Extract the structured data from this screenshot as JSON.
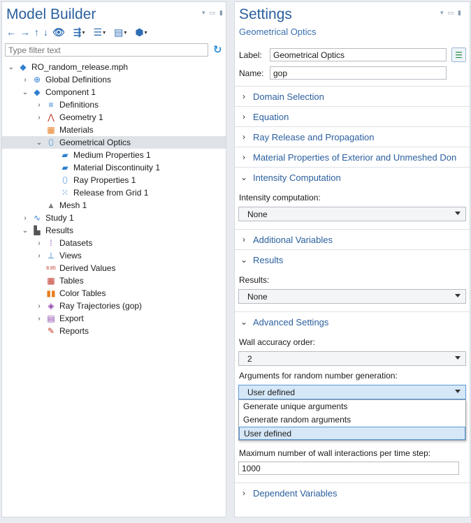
{
  "model_builder": {
    "title": "Model Builder",
    "filter_placeholder": "Type filter text",
    "toolbar": [
      {
        "name": "back-icon",
        "glyph": "←"
      },
      {
        "name": "forward-icon",
        "glyph": "→"
      },
      {
        "name": "move-up-icon",
        "glyph": "↑"
      },
      {
        "name": "move-down-icon",
        "glyph": "↓"
      },
      {
        "name": "show-icon",
        "glyph": "👁"
      },
      {
        "name": "expand-icon",
        "glyph": "⇶"
      },
      {
        "name": "collapse-icon",
        "glyph": "☰"
      },
      {
        "name": "list-icon",
        "glyph": "▤"
      },
      {
        "name": "build-icon",
        "glyph": "⬢"
      }
    ],
    "tree": [
      {
        "label": "RO_random_release.mph",
        "arrow": "⌄",
        "icon": "file-icon",
        "glyph": "◆",
        "color": "#2f7fd0"
      },
      {
        "label": "Global Definitions",
        "arrow": "›",
        "icon": "globe-icon",
        "glyph": "⊕",
        "color": "#2f7fd0"
      },
      {
        "label": "Component 1",
        "arrow": "⌄",
        "icon": "component-icon",
        "glyph": "◆",
        "color": "#2f7fd0"
      },
      {
        "label": "Definitions",
        "arrow": "›",
        "icon": "definitions-icon",
        "glyph": "≡",
        "color": "#2f7fd0"
      },
      {
        "label": "Geometry 1",
        "arrow": "›",
        "icon": "geometry-icon",
        "glyph": "⋀",
        "color": "#c0392b"
      },
      {
        "label": "Materials",
        "arrow": "",
        "icon": "materials-icon",
        "glyph": "▦",
        "color": "#e67e22"
      },
      {
        "label": "Geometrical Optics",
        "arrow": "⌄",
        "icon": "optics-icon",
        "glyph": "⬯",
        "color": "#2f7fd0"
      },
      {
        "label": "Medium Properties 1",
        "arrow": "",
        "icon": "medium-properties-icon",
        "glyph": "▰",
        "color": "#2f7fd0"
      },
      {
        "label": "Material Discontinuity 1",
        "arrow": "",
        "icon": "material-discontinuity-icon",
        "glyph": "▰",
        "color": "#2f7fd0"
      },
      {
        "label": "Ray Properties 1",
        "arrow": "",
        "icon": "ray-properties-icon",
        "glyph": "⬯",
        "color": "#2f7fd0"
      },
      {
        "label": "Release from Grid 1",
        "arrow": "",
        "icon": "release-grid-icon",
        "glyph": "⁙",
        "color": "#2f7fd0"
      },
      {
        "label": "Mesh 1",
        "arrow": "",
        "icon": "mesh-icon",
        "glyph": "▲",
        "color": "#808080"
      },
      {
        "label": "Study 1",
        "arrow": "›",
        "icon": "study-icon",
        "glyph": "∿",
        "color": "#2f7fd0"
      },
      {
        "label": "Results",
        "arrow": "⌄",
        "icon": "results-icon",
        "glyph": "▙",
        "color": "#555"
      },
      {
        "label": "Datasets",
        "arrow": "›",
        "icon": "datasets-icon",
        "glyph": "⁞",
        "color": "#8e44ad"
      },
      {
        "label": "Views",
        "arrow": "›",
        "icon": "views-icon",
        "glyph": "⊥",
        "color": "#2f7fd0"
      },
      {
        "label": "Derived Values",
        "arrow": "",
        "icon": "derived-values-icon",
        "glyph": "8.85",
        "color": "#c0392b"
      },
      {
        "label": "Tables",
        "arrow": "",
        "icon": "tables-icon",
        "glyph": "▦",
        "color": "#c0392b"
      },
      {
        "label": "Color Tables",
        "arrow": "",
        "icon": "color-tables-icon",
        "glyph": "▮▮",
        "color": "#e67e22"
      },
      {
        "label": "Ray Trajectories (gop)",
        "arrow": "›",
        "icon": "ray-trajectories-icon",
        "glyph": "◈",
        "color": "#8e44ad"
      },
      {
        "label": "Export",
        "arrow": "›",
        "icon": "export-icon",
        "glyph": "▤",
        "color": "#8e44ad"
      },
      {
        "label": "Reports",
        "arrow": "",
        "icon": "reports-icon",
        "glyph": "✎",
        "color": "#c0392b"
      }
    ]
  },
  "settings": {
    "title": "Settings",
    "subtitle": "Geometrical Optics",
    "label_caption": "Label:",
    "label_value": "Geometrical Optics",
    "name_caption": "Name:",
    "name_value": "gop",
    "sections": {
      "domain_selection": "Domain Selection",
      "equation": "Equation",
      "ray_release": "Ray Release and Propagation",
      "material_props": "Material Properties of Exterior and Unmeshed Don",
      "intensity": "Intensity Computation",
      "additional_vars": "Additional Variables",
      "results": "Results",
      "advanced": "Advanced Settings",
      "dependent_vars": "Dependent Variables"
    },
    "intensity_caption": "Intensity computation:",
    "intensity_value": "None",
    "results_caption": "Results:",
    "results_value": "None",
    "wall_accuracy_caption": "Wall accuracy order:",
    "wall_accuracy_value": "2",
    "random_args_caption": "Arguments for random number generation:",
    "random_args_value": "User defined",
    "random_args_options": [
      "Generate unique arguments",
      "Generate random arguments",
      "User defined"
    ],
    "max_wall_caption": "Maximum number of wall interactions per time step:",
    "max_wall_value": "1000"
  }
}
